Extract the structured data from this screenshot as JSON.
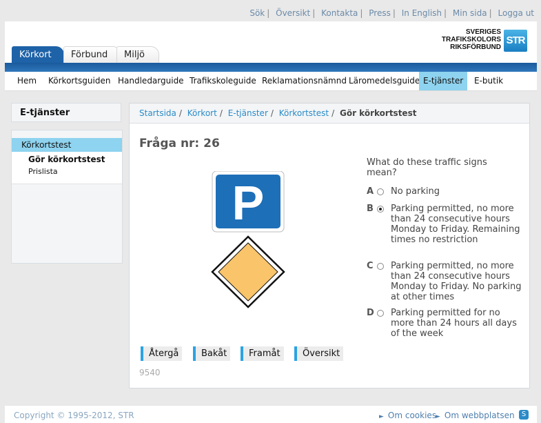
{
  "top_links": [
    "Sök",
    "Översikt",
    "Kontakta",
    "Press",
    "In English",
    "Min sida",
    "Logga ut"
  ],
  "logo": {
    "line1": "SVERIGES",
    "line2": "TRAFIKSKOLORS",
    "line3": "RIKSFÖRBUND",
    "badge": "STR"
  },
  "tabs": [
    {
      "label": "Körkort",
      "active": true
    },
    {
      "label": "Förbund",
      "active": false
    },
    {
      "label": "Miljö",
      "active": false
    }
  ],
  "subnav": [
    {
      "label": "Hem"
    },
    {
      "label": "Körkortsguiden"
    },
    {
      "label": "Handledarguide"
    },
    {
      "label": "Trafikskoleguide"
    },
    {
      "label": "Reklamationsnämnd"
    },
    {
      "label": "Läromedelsguide"
    },
    {
      "label": "E-tjänster",
      "active": true
    },
    {
      "label": "E-butik"
    }
  ],
  "sidebar": {
    "title": "E-tjänster",
    "selected": "Körkortstest",
    "sub_items": [
      "Gör körkortstest",
      "Prislista"
    ]
  },
  "breadcrumb": {
    "links": [
      "Startsida",
      "Körkort",
      "E-tjänster",
      "Körkortstest"
    ],
    "current": "Gör körkortstest"
  },
  "question": {
    "title": "Fråga nr: 26",
    "text": "What do these traffic signs mean?",
    "signs": [
      "parking-sign-icon",
      "priority-road-sign-icon"
    ],
    "options": [
      {
        "letter": "A",
        "text": "No parking",
        "checked": false
      },
      {
        "letter": "B",
        "text": "Parking permitted, no more than 24 consecutive hours Monday to Friday. Remaining times no restriction",
        "checked": true
      },
      {
        "letter": "C",
        "text": "Parking permitted, no more than 24 consecutive hours Monday to Friday. No parking at other times",
        "checked": false
      },
      {
        "letter": "D",
        "text": "Parking permitted for no more than 24 hours all days of the week",
        "checked": false
      }
    ],
    "id": "9540"
  },
  "buttons": {
    "back": "Återgå",
    "prev": "Bakåt",
    "next": "Framåt",
    "overview": "Översikt"
  },
  "footer": {
    "copyright": "Copyright © 1995-2012, STR",
    "links": [
      "Om cookies",
      "Om webbplatsen"
    ]
  },
  "colors": {
    "brand_blue": "#1e62a8",
    "highlight": "#8ed3ef",
    "link": "#2a8bc7"
  }
}
